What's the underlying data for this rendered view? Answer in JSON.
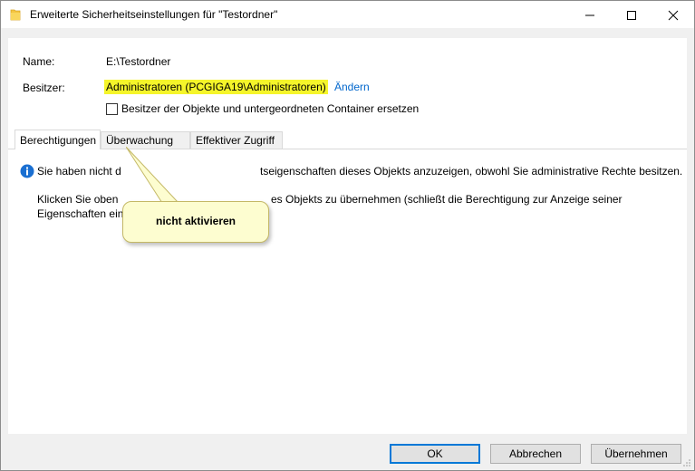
{
  "window": {
    "title": "Erweiterte Sicherheitseinstellungen für \"Testordner\""
  },
  "fields": {
    "name_label": "Name:",
    "name_value": "E:\\Testordner",
    "owner_label": "Besitzer:",
    "owner_value": "Administratoren (PCGIGA19\\Administratoren)",
    "owner_change_link": "Ändern",
    "replace_owner_checkbox": "Besitzer der Objekte und untergeordneten Container ersetzen",
    "replace_owner_checked": false
  },
  "tabs": [
    {
      "label": "Berechtigungen",
      "active": true
    },
    {
      "label": "Überwachung",
      "active": false
    },
    {
      "label": "Effektiver Zugriff",
      "active": false
    }
  ],
  "info": {
    "line1_left": "Sie haben nicht d",
    "line1_right": "tseigenschaften dieses Objekts anzuzeigen, obwohl Sie administrative Rechte besitzen.",
    "line2_left": "Klicken Sie oben",
    "line2_right": "es Objekts zu übernehmen (schließt die Berechtigung zur Anzeige seiner",
    "line3": "Eigenschaften ein)."
  },
  "callout": {
    "text": "nicht aktivieren"
  },
  "buttons": {
    "ok": "OK",
    "cancel": "Abbrechen",
    "apply": "Übernehmen"
  },
  "colors": {
    "highlight": "#f5f52a",
    "link": "#0066cc",
    "callout_bg": "#fdfdd0",
    "default_button_border": "#0078d7",
    "info_icon": "#1a6fd1"
  }
}
